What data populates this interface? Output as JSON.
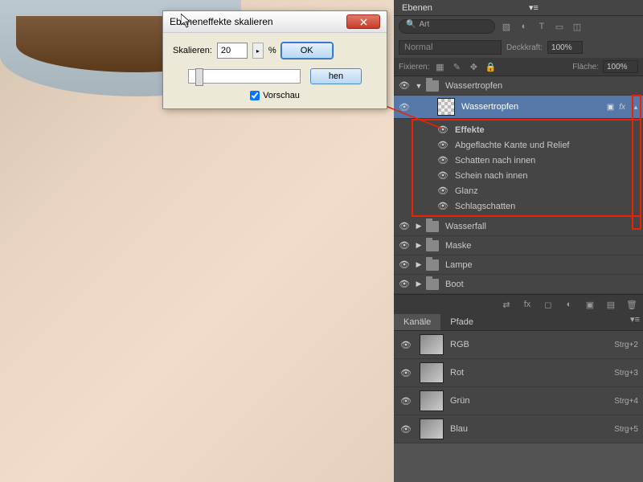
{
  "dialog": {
    "title": "Ebeneneffekte skalieren",
    "label": "Skalieren:",
    "value": "20",
    "unit": "%",
    "ok": "OK",
    "cancel": "hen",
    "preview": "Vorschau"
  },
  "layers_panel": {
    "title": "Ebenen",
    "search_placeholder": "Art",
    "blend_mode": "Normal",
    "opacity_label": "Deckkraft:",
    "opacity_value": "100%",
    "lock_label": "Fixieren:",
    "fill_label": "Fläche:",
    "fill_value": "100%",
    "groups": [
      {
        "name": "Wassertropfen",
        "expanded": true
      },
      {
        "name": "Wasserfall",
        "expanded": false
      },
      {
        "name": "Maske",
        "expanded": false
      },
      {
        "name": "Lampe",
        "expanded": false
      },
      {
        "name": "Boot",
        "expanded": false
      }
    ],
    "active_layer": "Wassertropfen",
    "fx_label": "fx",
    "effects_title": "Effekte",
    "effects": [
      "Abgeflachte Kante und Relief",
      "Schatten nach innen",
      "Schein nach innen",
      "Glanz",
      "Schlagschatten"
    ]
  },
  "channels_panel": {
    "tab1": "Kanäle",
    "tab2": "Pfade",
    "channels": [
      {
        "name": "RGB",
        "shortcut": "Strg+2"
      },
      {
        "name": "Rot",
        "shortcut": "Strg+3"
      },
      {
        "name": "Grün",
        "shortcut": "Strg+4"
      },
      {
        "name": "Blau",
        "shortcut": "Strg+5"
      }
    ]
  }
}
